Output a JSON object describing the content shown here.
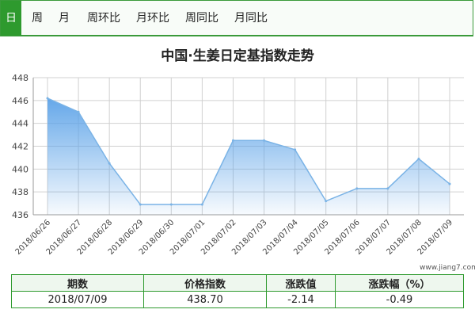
{
  "tabs": [
    {
      "label": "日",
      "active": true
    },
    {
      "label": "周",
      "active": false
    },
    {
      "label": "月",
      "active": false
    },
    {
      "label": "周环比",
      "active": false
    },
    {
      "label": "月环比",
      "active": false
    },
    {
      "label": "周同比",
      "active": false
    },
    {
      "label": "月同比",
      "active": false
    }
  ],
  "watermark": "www.jiang7.com",
  "colors": {
    "accent": "#2e9a2e",
    "line": "#7ab3e6",
    "fill_top": "#5da3e8",
    "grid": "#d0d0d0"
  },
  "chart_data": {
    "type": "area",
    "title": "中国·生姜日定基指数走势",
    "xlabel": "",
    "ylabel": "",
    "x": [
      "2018/06/26",
      "2018/06/27",
      "2018/06/28",
      "2018/06/29",
      "2018/06/30",
      "2018/07/01",
      "2018/07/02",
      "2018/07/03",
      "2018/07/04",
      "2018/07/05",
      "2018/07/06",
      "2018/07/07",
      "2018/07/08",
      "2018/07/09"
    ],
    "series": [
      {
        "values": [
          446.2,
          445.0,
          440.5,
          436.9,
          436.9,
          436.9,
          442.5,
          442.5,
          441.7,
          437.2,
          438.3,
          438.3,
          440.9,
          438.7
        ]
      }
    ],
    "ylim": [
      436,
      448
    ],
    "yticks": [
      "436",
      "438",
      "440",
      "442",
      "444",
      "446",
      "448"
    ],
    "grid": true,
    "legend": "none"
  },
  "table": {
    "headers": [
      "期数",
      "价格指数",
      "涨跌值",
      "涨跌幅（%）"
    ],
    "row": [
      "2018/07/09",
      "438.70",
      "-2.14",
      "-0.49"
    ]
  }
}
